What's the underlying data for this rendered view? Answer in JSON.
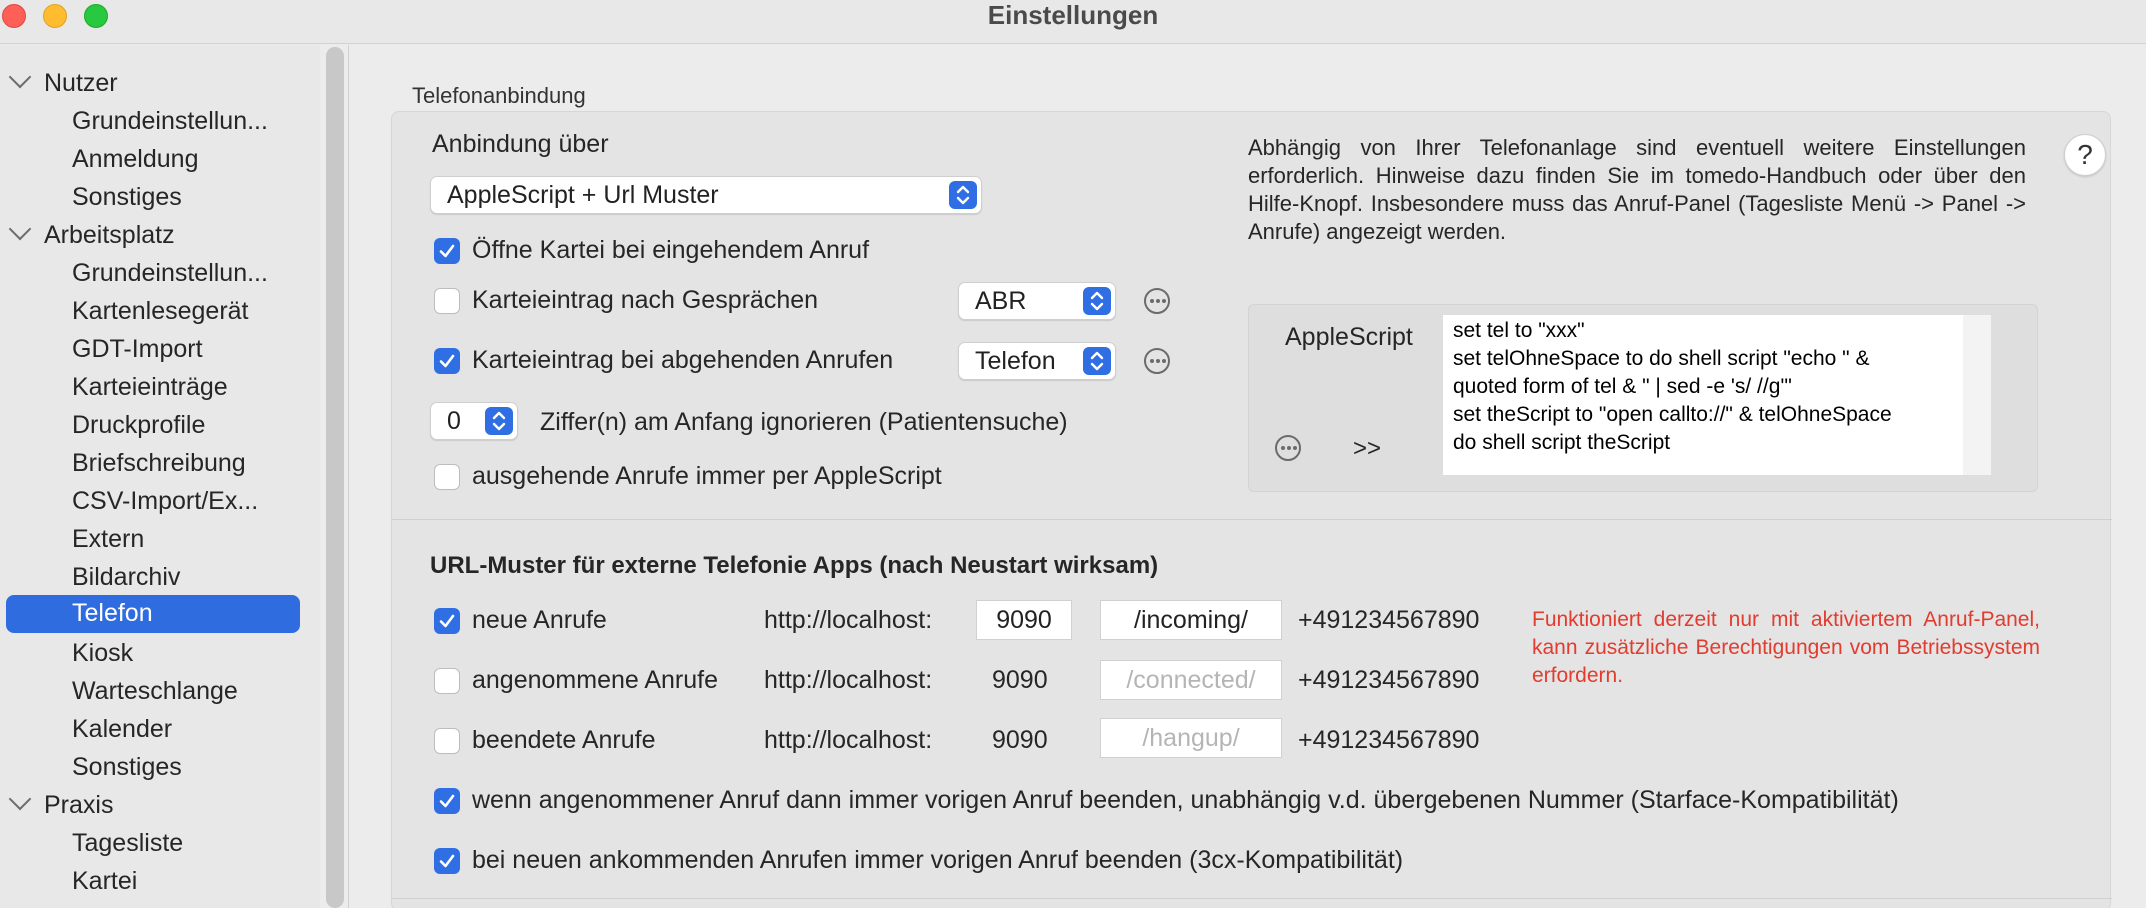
{
  "window": {
    "title": "Einstellungen"
  },
  "sidebar": {
    "groups": [
      {
        "label": "Nutzer",
        "items": [
          "Grundeinstellun...",
          "Anmeldung",
          "Sonstiges"
        ]
      },
      {
        "label": "Arbeitsplatz",
        "items": [
          "Grundeinstellun...",
          "Kartenlesegerät",
          "GDT-Import",
          "Karteieinträge",
          "Druckprofile",
          "Briefschreibung",
          "CSV-Import/Ex...",
          "Extern",
          "Bildarchiv",
          "Telefon",
          "Kiosk",
          "Warteschlange",
          "Kalender",
          "Sonstiges"
        ]
      },
      {
        "label": "Praxis",
        "items": [
          "Tagesliste",
          "Kartei"
        ]
      }
    ],
    "selected": "Telefon"
  },
  "telefon": {
    "section_label": "Telefonanbindung",
    "anbindung_label": "Anbindung über",
    "anbindung_value": "AppleScript + Url Muster",
    "oeffne_kartei": {
      "label": "Öffne Kartei bei eingehendem Anruf",
      "checked": true
    },
    "eintrag_nach": {
      "label": "Karteieintrag nach Gesprächen",
      "checked": false,
      "select": "ABR"
    },
    "eintrag_abgehend": {
      "label": "Karteieintrag bei abgehenden Anrufen",
      "checked": true,
      "select": "Telefon"
    },
    "ziffern": {
      "value": "0",
      "label": "Ziffer(n) am Anfang ignorieren (Patientensuche)"
    },
    "ausgehend_applescript": {
      "label": "ausgehende Anrufe immer per AppleScript",
      "checked": false
    },
    "info_text": "Abhängig von Ihrer Telefonanlage sind eventuell weitere Einstellungen erforderlich. Hinweise dazu finden Sie im tomedo-Handbuch oder über den Hilfe-Knopf. Insbesondere muss das Anruf-Panel (Tagesliste Menü -> Panel -> Anrufe) angezeigt werden.",
    "help_label": "?",
    "applescript_label": "AppleScript",
    "applescript_expand": ">>",
    "applescript_code": "set tel to \"xxx\"\nset telOhneSpace to do shell script \"echo \" &\nquoted form of tel & \" | sed -e 's/ //g'\"\nset theScript to \"open callto://\" & telOhneSpace\ndo shell script theScript"
  },
  "url_muster": {
    "title": "URL-Muster für externe Telefonie Apps (nach Neustart wirksam)",
    "rows": [
      {
        "label": "neue Anrufe",
        "checked": true,
        "host": "http://localhost:",
        "port": "9090",
        "path": "/incoming/",
        "path_placeholder": false,
        "number": "+491234567890"
      },
      {
        "label": "angenommene Anrufe",
        "checked": false,
        "host": "http://localhost:",
        "port": "9090",
        "path": "/connected/",
        "path_placeholder": true,
        "number": "+491234567890"
      },
      {
        "label": "beendete Anrufe",
        "checked": false,
        "host": "http://localhost:",
        "port": "9090",
        "path": "/hangup/",
        "path_placeholder": true,
        "number": "+491234567890"
      }
    ],
    "warning": "Funktioniert derzeit nur mit aktiviertem Anruf-Panel, kann zusätzliche Berechtigungen vom Betriebssystem erfordern.",
    "opt_starface": {
      "label": "wenn angenommener Anruf dann immer vorigen Anruf beenden, unabhängig v.d. übergebenen Nummer (Starface-Kompatibilität)",
      "checked": true
    },
    "opt_3cx": {
      "label": "bei neuen ankommenden Anrufen immer vorigen Anruf beenden (3cx-Kompatibilität)",
      "checked": true
    }
  },
  "colors": {
    "accent": "#2f6fe3",
    "selection": "#2e6ce0",
    "warning": "#e13c2e"
  }
}
